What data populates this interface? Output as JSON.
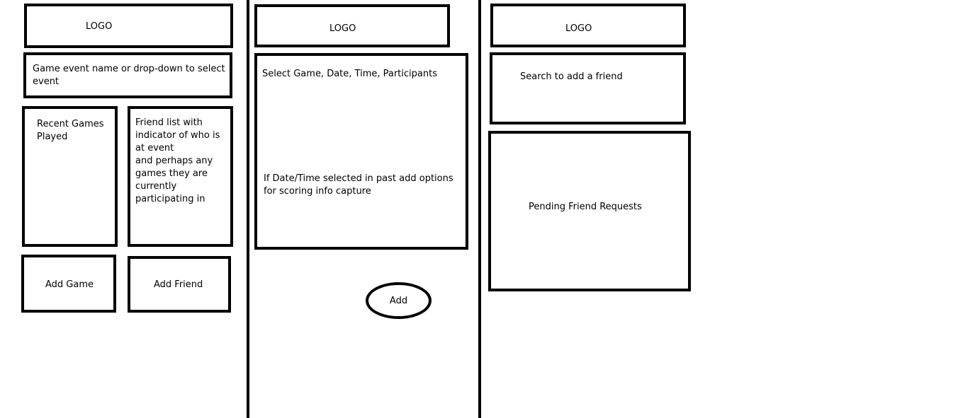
{
  "screen1": {
    "logo": "LOGO",
    "event_selector": "Game event name or drop-down to select\nevent",
    "recent_games": "Recent Games\nPlayed",
    "friend_list": "Friend list with\nindicator of who is\nat event\nand perhaps any\ngames they are\ncurrently\nparticipating in",
    "add_game": "Add Game",
    "add_friend": "Add Friend"
  },
  "screen2": {
    "logo": "LOGO",
    "select_line": "Select Game, Date, Time, Participants",
    "past_note": "If Date/Time selected in past add options\nfor scoring info capture",
    "add": "Add"
  },
  "screen3": {
    "logo": "LOGO",
    "search": "Search to add a friend",
    "pending": "Pending Friend Requests"
  }
}
